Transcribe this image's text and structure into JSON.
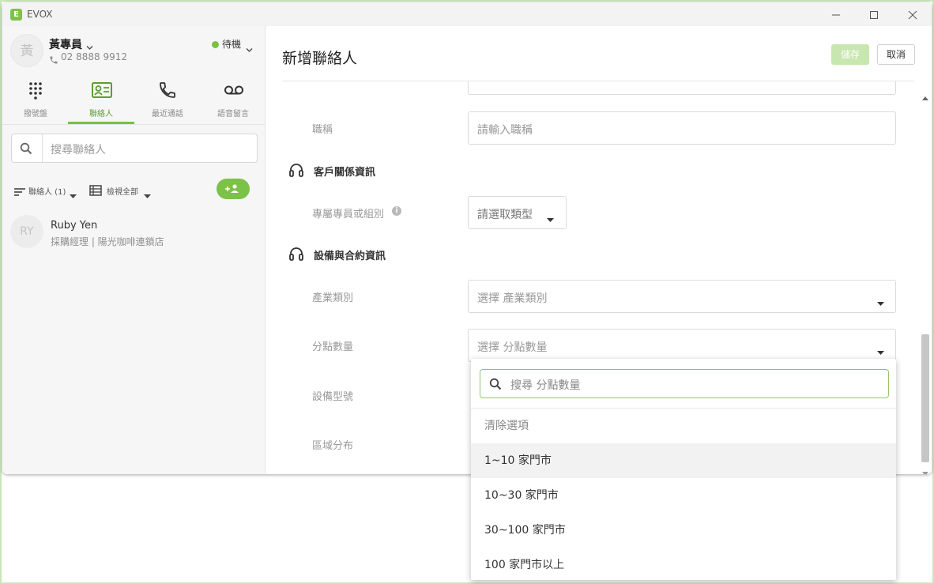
{
  "window": {
    "app_title": "EVOX",
    "logo_letter": "E"
  },
  "user": {
    "avatar_text": "黃",
    "name": "黃專員",
    "phone": "02 8888 9912",
    "status": "待機"
  },
  "nav": {
    "tabs": [
      {
        "label": "撥號盤"
      },
      {
        "label": "聯絡人"
      },
      {
        "label": "最近通話"
      },
      {
        "label": "語音留言"
      }
    ]
  },
  "sidebar": {
    "search_placeholder": "搜尋聯絡人",
    "filter_label": "聯絡人 (1)",
    "view_label": "檢視全部",
    "contacts": [
      {
        "avatar_text": "RY",
        "name": "Ruby Yen",
        "subtitle": "採購經理 | 陽光咖啡連鎖店"
      }
    ]
  },
  "header": {
    "title": "新增聯絡人",
    "save_label": "儲存",
    "cancel_label": "取消"
  },
  "form": {
    "job_title": {
      "label": "職稱",
      "placeholder": "請輸入職稱"
    },
    "crm_section": {
      "title": "客戶關係資訊"
    },
    "owner": {
      "label": "專屬專員或組別",
      "placeholder": "請選取類型"
    },
    "equipment_section": {
      "title": "設備與合約資訊"
    },
    "industry": {
      "label": "產業類別",
      "placeholder": "選擇 產業類別"
    },
    "branches": {
      "label": "分點數量",
      "placeholder": "選擇 分點數量"
    },
    "model": {
      "label": "設備型號"
    },
    "region": {
      "label": "區域分布"
    }
  },
  "dropdown": {
    "search_placeholder": "搜尋 分點數量",
    "clear_label": "清除選項",
    "options": [
      "1~10 家門市",
      "10~30 家門市",
      "30~100 家門市",
      "100 家門市以上"
    ]
  },
  "colors": {
    "accent": "#79c043",
    "save_disabled": "#c8e6b0",
    "frame": "#c9e6b8"
  }
}
